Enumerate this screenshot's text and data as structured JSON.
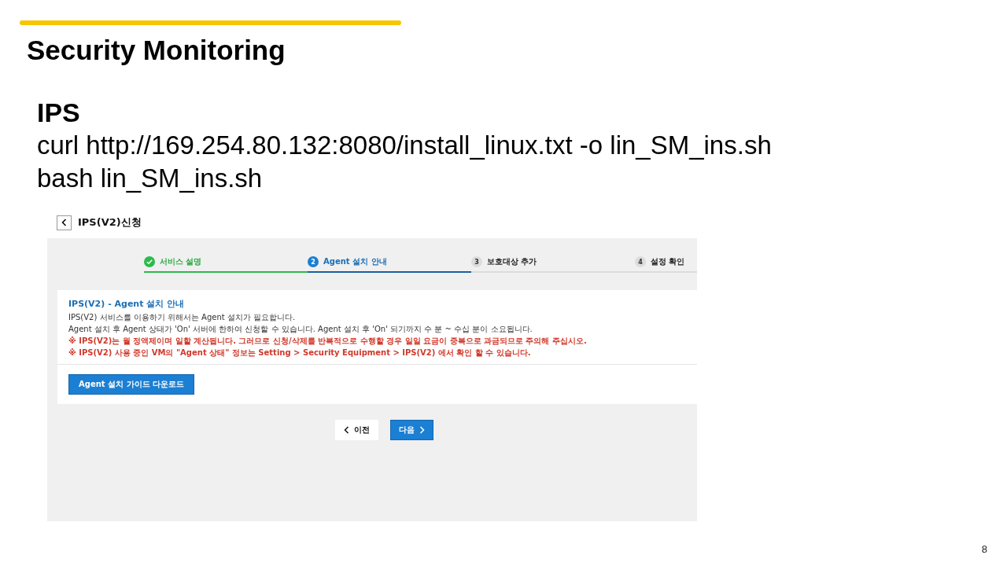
{
  "slide": {
    "title": "Security Monitoring",
    "page_number": "8"
  },
  "command_block": {
    "heading": "IPS",
    "lines": [
      "curl http://169.254.80.132:8080/install_linux.txt -o lin_SM_ins.sh",
      "bash lin_SM_ins.sh"
    ]
  },
  "screenshot": {
    "page_title": "IPS(V2)신청",
    "steps": [
      {
        "label": "서비스 설명",
        "completed": true,
        "selected": false
      },
      {
        "number": "2",
        "label": "Agent 설치 안내",
        "completed": false,
        "selected": true
      },
      {
        "number": "3",
        "label": "보호대상 추가",
        "completed": false,
        "selected": false
      },
      {
        "number": "4",
        "label": "설정 확인",
        "completed": false,
        "selected": false
      }
    ],
    "card": {
      "title": "IPS(V2) - Agent 설치 안내",
      "lines": [
        {
          "kind": "plain",
          "text": "IPS(V2) 서비스를 이용하기 위해서는 Agent 설치가 필요합니다."
        },
        {
          "kind": "plain",
          "text": "Agent 설치 후 Agent 상태가 'On' 서버에 한하여 신청할 수 있습니다.  Agent 설치 후 'On' 되기까지 수 분 ~ 수십 분이 소요됩니다."
        },
        {
          "kind": "warning",
          "text": "※ IPS(V2)는 월 정액제이며 일할 계산됩니다. 그러므로 신청/삭제를 반복적으로 수행할 경우 일일 요금이 중복으로 과금되므로 주의해 주십시오."
        },
        {
          "kind": "warning",
          "text": "※ IPS(V2) 사용 중인 VM의 \"Agent 상태\" 정보는 Setting > Security Equipment > IPS(V2) 에서 확인 할 수 있습니다."
        }
      ],
      "download_button": "Agent 설치 가이드 다운로드"
    },
    "prev_button": "이전",
    "next_button": "다음"
  }
}
